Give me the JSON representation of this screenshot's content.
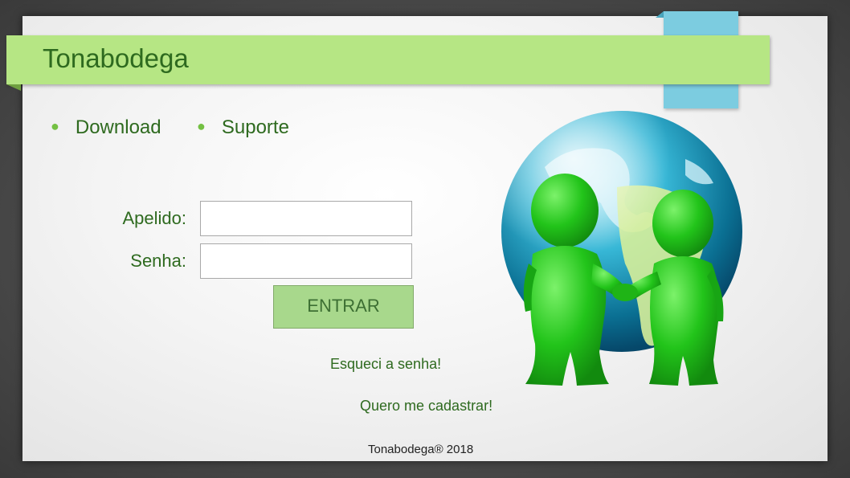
{
  "header": {
    "title": "Tonabodega"
  },
  "nav": {
    "items": [
      {
        "label": "Download"
      },
      {
        "label": "Suporte"
      }
    ]
  },
  "login": {
    "apelido_label": "Apelido:",
    "apelido_value": "",
    "senha_label": "Senha:",
    "senha_value": "",
    "submit_label": "ENTRAR"
  },
  "links": {
    "forgot": "Esqueci a senha!",
    "register": "Quero me cadastrar!"
  },
  "footer": {
    "copyright": "Tonabodega® 2018"
  },
  "colors": {
    "banner": "#b6e684",
    "accent_tab": "#7ccce0",
    "text_green": "#2e6a1f",
    "button": "#a8d88c",
    "figure_green": "#22c41a"
  },
  "icons": {
    "illustration": "globe-handshake-illustration"
  }
}
